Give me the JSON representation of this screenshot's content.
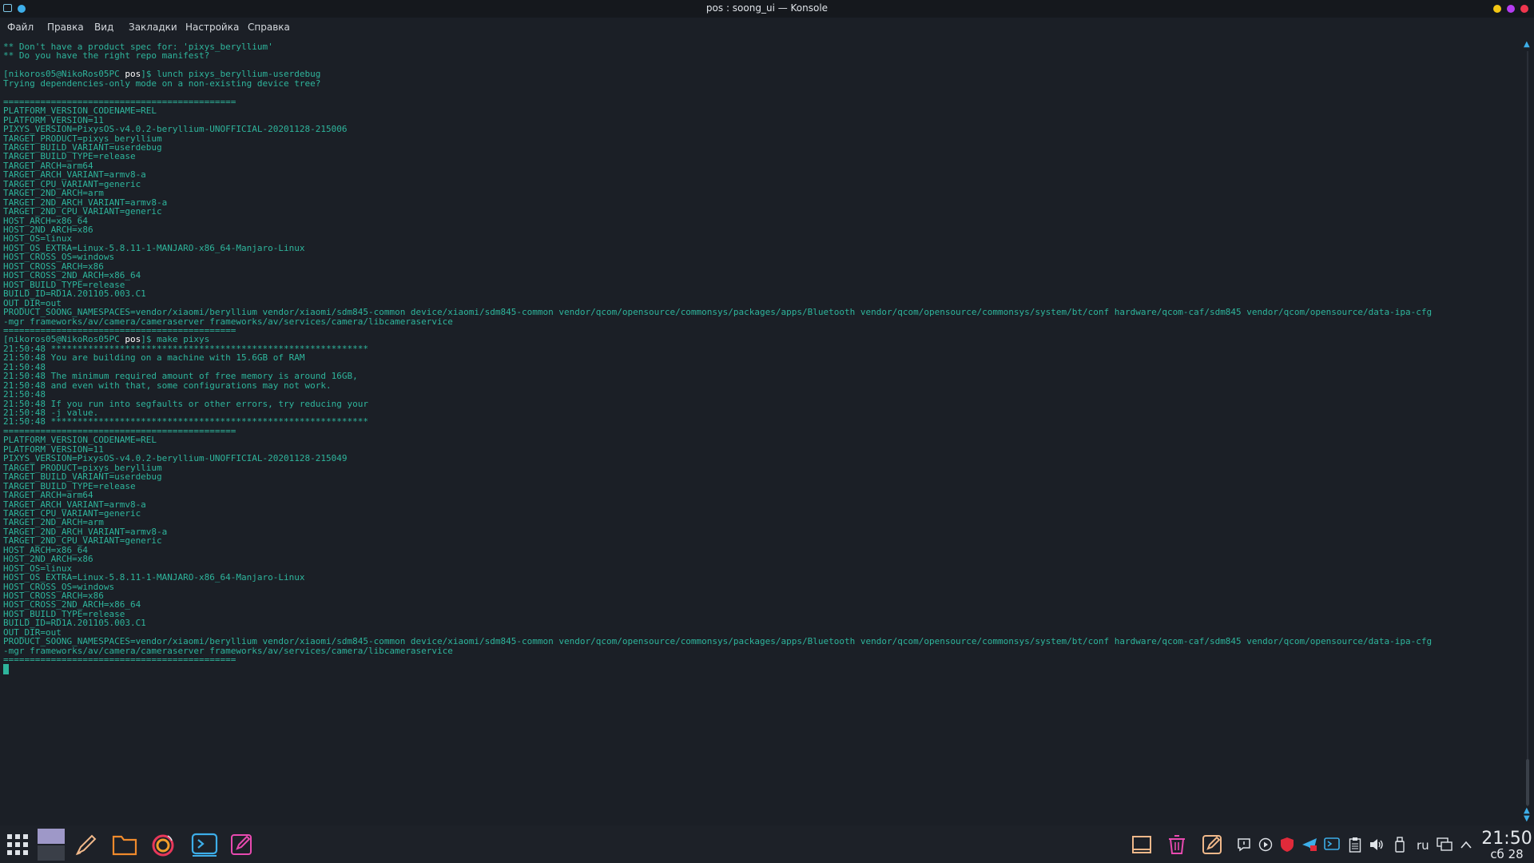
{
  "window": {
    "title": "pos : soong_ui — Konsole"
  },
  "menu": [
    "Файл",
    "Правка",
    "Вид",
    "Закладки",
    "Настройка",
    "Справка"
  ],
  "colors": {
    "terminal_bg": "#1b1f26",
    "terminal_fg": "#2eb59c",
    "accent": "#3daee9"
  },
  "terminal": {
    "prompt_user": "[nikoros05@NikoRos05PC ",
    "prompt_dir": "pos",
    "prompt_end": "]$ ",
    "lines": [
      "** Don't have a product spec for: 'pixys_beryllium'",
      "** Do you have the right repo manifest?",
      "",
      {
        "prompt": true,
        "cmd": "lunch pixys_beryllium-userdebug"
      },
      "Trying dependencies-only mode on a non-existing device tree?",
      "",
      "============================================",
      "PLATFORM_VERSION_CODENAME=REL",
      "PLATFORM_VERSION=11",
      "PIXYS_VERSION=PixysOS-v4.0.2-beryllium-UNOFFICIAL-20201128-215006",
      "TARGET_PRODUCT=pixys_beryllium",
      "TARGET_BUILD_VARIANT=userdebug",
      "TARGET_BUILD_TYPE=release",
      "TARGET_ARCH=arm64",
      "TARGET_ARCH_VARIANT=armv8-a",
      "TARGET_CPU_VARIANT=generic",
      "TARGET_2ND_ARCH=arm",
      "TARGET_2ND_ARCH_VARIANT=armv8-a",
      "TARGET_2ND_CPU_VARIANT=generic",
      "HOST_ARCH=x86_64",
      "HOST_2ND_ARCH=x86",
      "HOST_OS=linux",
      "HOST_OS_EXTRA=Linux-5.8.11-1-MANJARO-x86_64-Manjaro-Linux",
      "HOST_CROSS_OS=windows",
      "HOST_CROSS_ARCH=x86",
      "HOST_CROSS_2ND_ARCH=x86_64",
      "HOST_BUILD_TYPE=release",
      "BUILD_ID=RD1A.201105.003.C1",
      "OUT_DIR=out",
      "PRODUCT_SOONG_NAMESPACES=vendor/xiaomi/beryllium vendor/xiaomi/sdm845-common device/xiaomi/sdm845-common vendor/qcom/opensource/commonsys/packages/apps/Bluetooth vendor/qcom/opensource/commonsys/system/bt/conf hardware/qcom-caf/sdm845 vendor/qcom/opensource/data-ipa-cfg",
      "-mgr frameworks/av/camera/cameraserver frameworks/av/services/camera/libcameraservice",
      "============================================",
      {
        "prompt": true,
        "cmd": "make pixys"
      },
      "21:50:48 ************************************************************",
      "21:50:48 You are building on a machine with 15.6GB of RAM",
      "21:50:48",
      "21:50:48 The minimum required amount of free memory is around 16GB,",
      "21:50:48 and even with that, some configurations may not work.",
      "21:50:48",
      "21:50:48 If you run into segfaults or other errors, try reducing your",
      "21:50:48 -j value.",
      "21:50:48 ************************************************************",
      "============================================",
      "PLATFORM_VERSION_CODENAME=REL",
      "PLATFORM_VERSION=11",
      "PIXYS_VERSION=PixysOS-v4.0.2-beryllium-UNOFFICIAL-20201128-215049",
      "TARGET_PRODUCT=pixys_beryllium",
      "TARGET_BUILD_VARIANT=userdebug",
      "TARGET_BUILD_TYPE=release",
      "TARGET_ARCH=arm64",
      "TARGET_ARCH_VARIANT=armv8-a",
      "TARGET_CPU_VARIANT=generic",
      "TARGET_2ND_ARCH=arm",
      "TARGET_2ND_ARCH_VARIANT=armv8-a",
      "TARGET_2ND_CPU_VARIANT=generic",
      "HOST_ARCH=x86_64",
      "HOST_2ND_ARCH=x86",
      "HOST_OS=linux",
      "HOST_OS_EXTRA=Linux-5.8.11-1-MANJARO-x86_64-Manjaro-Linux",
      "HOST_CROSS_OS=windows",
      "HOST_CROSS_ARCH=x86",
      "HOST_CROSS_2ND_ARCH=x86_64",
      "HOST_BUILD_TYPE=release",
      "BUILD_ID=RD1A.201105.003.C1",
      "OUT_DIR=out",
      "PRODUCT_SOONG_NAMESPACES=vendor/xiaomi/beryllium vendor/xiaomi/sdm845-common device/xiaomi/sdm845-common vendor/qcom/opensource/commonsys/packages/apps/Bluetooth vendor/qcom/opensource/commonsys/system/bt/conf hardware/qcom-caf/sdm845 vendor/qcom/opensource/data-ipa-cfg",
      "-mgr frameworks/av/camera/cameraserver frameworks/av/services/camera/libcameraservice",
      "============================================"
    ]
  },
  "taskbar": {
    "apps": [
      "app-launcher-icon",
      "pager-icon",
      "kate-icon",
      "dolphin-icon",
      "firefox-icon",
      "konsole-icon",
      "kwrite-icon"
    ],
    "tray_icons": [
      "show-desktop-icon",
      "trash-icon",
      "notes-icon",
      "notifications-icon",
      "media-player-icon",
      "antivirus-icon",
      "telegram-icon",
      "konsole-tray-icon",
      "clipboard-icon",
      "volume-icon",
      "usb-icon"
    ],
    "language": "ru",
    "clock_time": "21:50",
    "clock_date": "сб 28"
  }
}
